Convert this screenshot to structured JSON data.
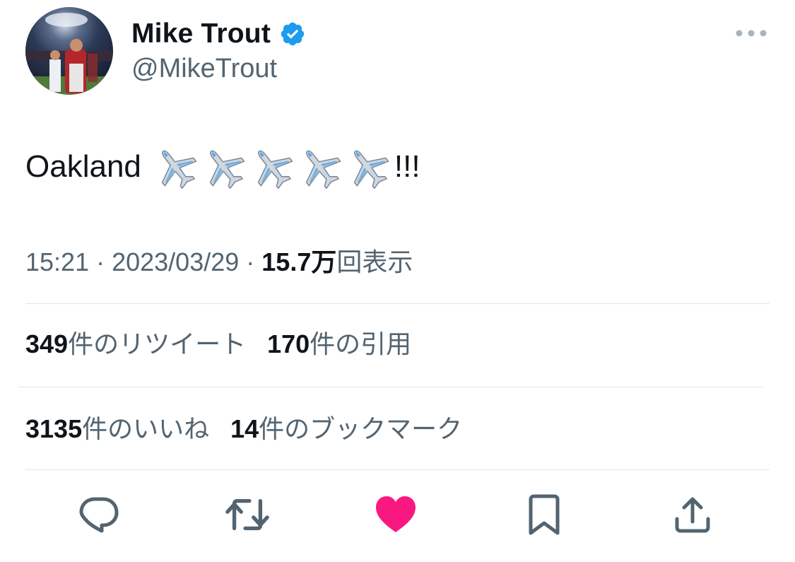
{
  "user": {
    "display_name": "Mike Trout",
    "handle": "@MikeTrout",
    "verified": true
  },
  "tweet": {
    "text": "Oakland",
    "emoji": [
      "airplane",
      "airplane",
      "airplane",
      "airplane",
      "airplane"
    ],
    "suffix": "!!!"
  },
  "meta": {
    "time": "15:21",
    "sep1": " · ",
    "date": "2023/03/29",
    "sep2": " · ",
    "views_count": "15.7万",
    "views_label": "回表示"
  },
  "stats": {
    "retweets_count": "349",
    "retweets_label": "件のリツイート",
    "quotes_count": "170",
    "quotes_label": "件の引用",
    "likes_count": "3135",
    "likes_label": "件のいいね",
    "bookmarks_count": "14",
    "bookmarks_label": "件のブックマーク"
  },
  "actions": {
    "reply_icon": "reply-icon",
    "retweet_icon": "retweet-icon",
    "like_icon": "heart-icon",
    "bookmark_icon": "bookmark-icon",
    "share_icon": "share-icon"
  },
  "colors": {
    "verified_blue": "#1d9bf0",
    "like_pink": "#f91880",
    "secondary_text": "#536471",
    "primary_text": "#0f1419",
    "divider": "#e1e6ea"
  }
}
